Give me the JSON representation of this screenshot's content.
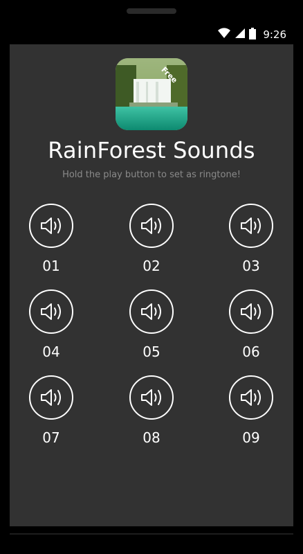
{
  "status_bar": {
    "time": "9:26",
    "icons": [
      "wifi-icon",
      "signal-icon",
      "battery-icon"
    ]
  },
  "app": {
    "icon_badge": "Free",
    "title": "RainForest Sounds",
    "subtitle": "Hold the play button to set as ringtone!"
  },
  "sounds": [
    {
      "label": "01"
    },
    {
      "label": "02"
    },
    {
      "label": "03"
    },
    {
      "label": "04"
    },
    {
      "label": "05"
    },
    {
      "label": "06"
    },
    {
      "label": "07"
    },
    {
      "label": "08"
    },
    {
      "label": "09"
    }
  ],
  "colors": {
    "background": "#323232",
    "accent_badge": "#1abc9c",
    "text": "#ffffff",
    "subtitle": "#8a8a8a"
  }
}
